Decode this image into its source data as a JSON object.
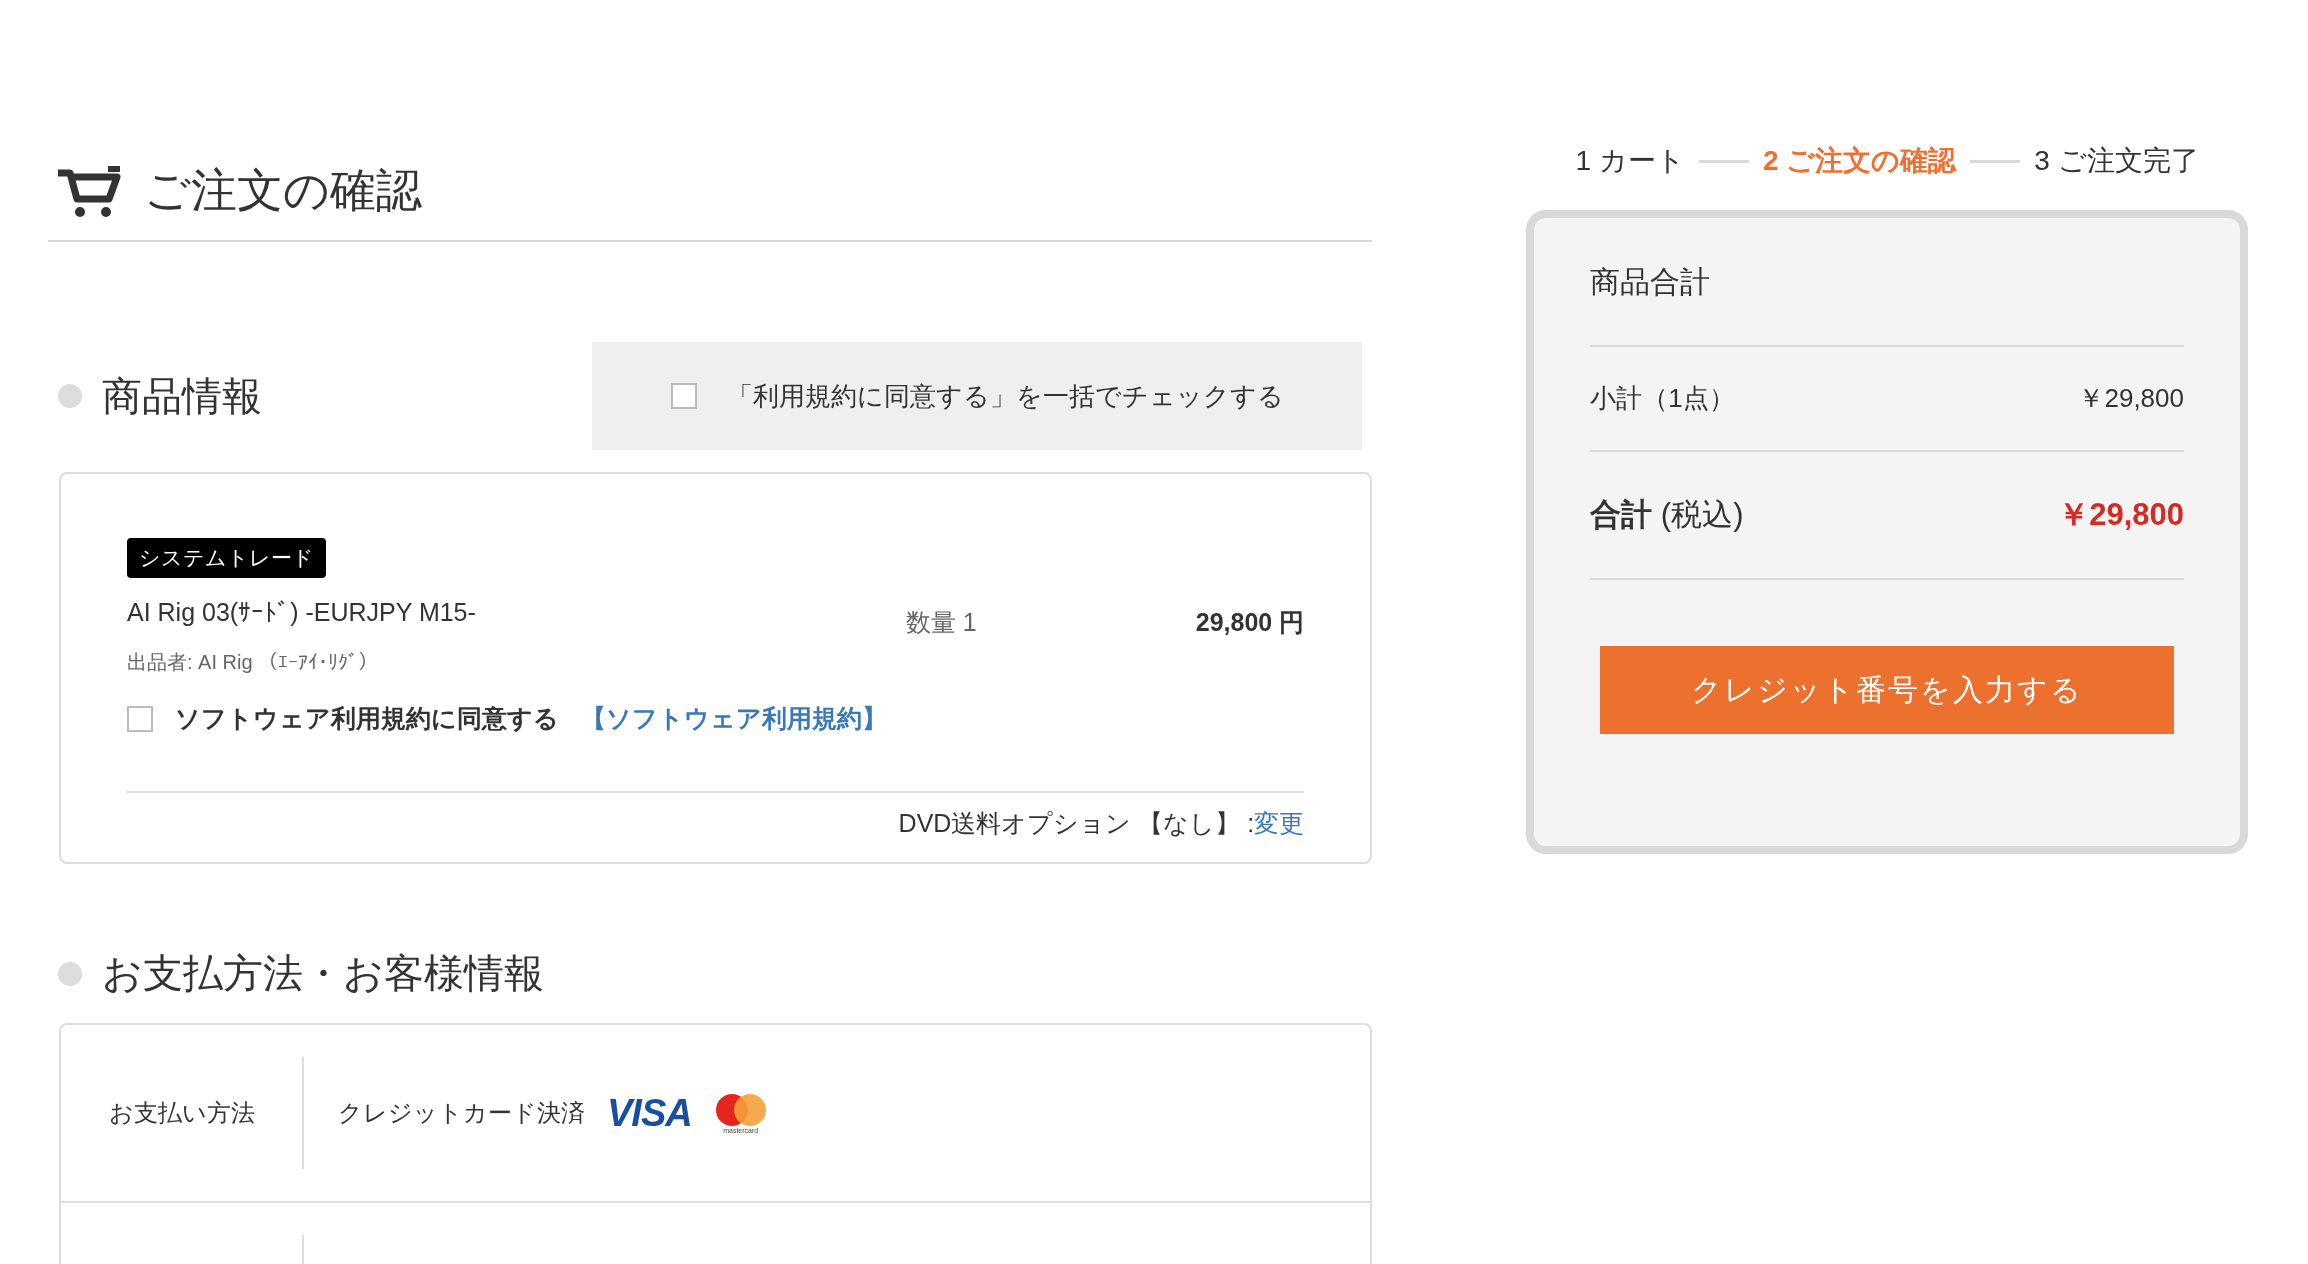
{
  "header": {
    "title": "ご注文の確認"
  },
  "steps": [
    {
      "label": "1 カート",
      "selected": false
    },
    {
      "label": "2 ご注文の確認",
      "selected": true
    },
    {
      "label": "3 ご注文完了",
      "selected": false
    }
  ],
  "product_section": {
    "heading": "商品情報",
    "bulk_agree": {
      "label": "「利用規約に同意する」を一括でチェックする",
      "checked": false
    }
  },
  "product": {
    "tag": "システムトレード",
    "name": "AI Rig 03(ｻｰﾄﾞ) -EURJPY M15-",
    "seller": "出品者: AI Rig （ｴｰｱｲ･ﾘｸﾞ）",
    "quantity": "数量 1",
    "price": "29,800 円",
    "agree": {
      "label": "ソフトウェア利用規約に同意する",
      "link": "【ソフトウェア利用規約】",
      "checked": false
    },
    "dvd_option": "DVD送料オプション 【なし】 :",
    "change_link": "変更"
  },
  "summary": {
    "title": "商品合計",
    "subtotal_label": "小計（1点）",
    "subtotal": "￥29,800",
    "total_label": "**合計** (税込)",
    "total": "￥29,800",
    "button": "クレジット番号を入力する"
  },
  "payment_section": {
    "heading": "お支払方法・お客様情報",
    "rows": [
      {
        "label": "お支払い方法",
        "value": "クレジットカード決済",
        "visa": "VISA",
        "mastercard": "mastercard"
      }
    ]
  }
}
